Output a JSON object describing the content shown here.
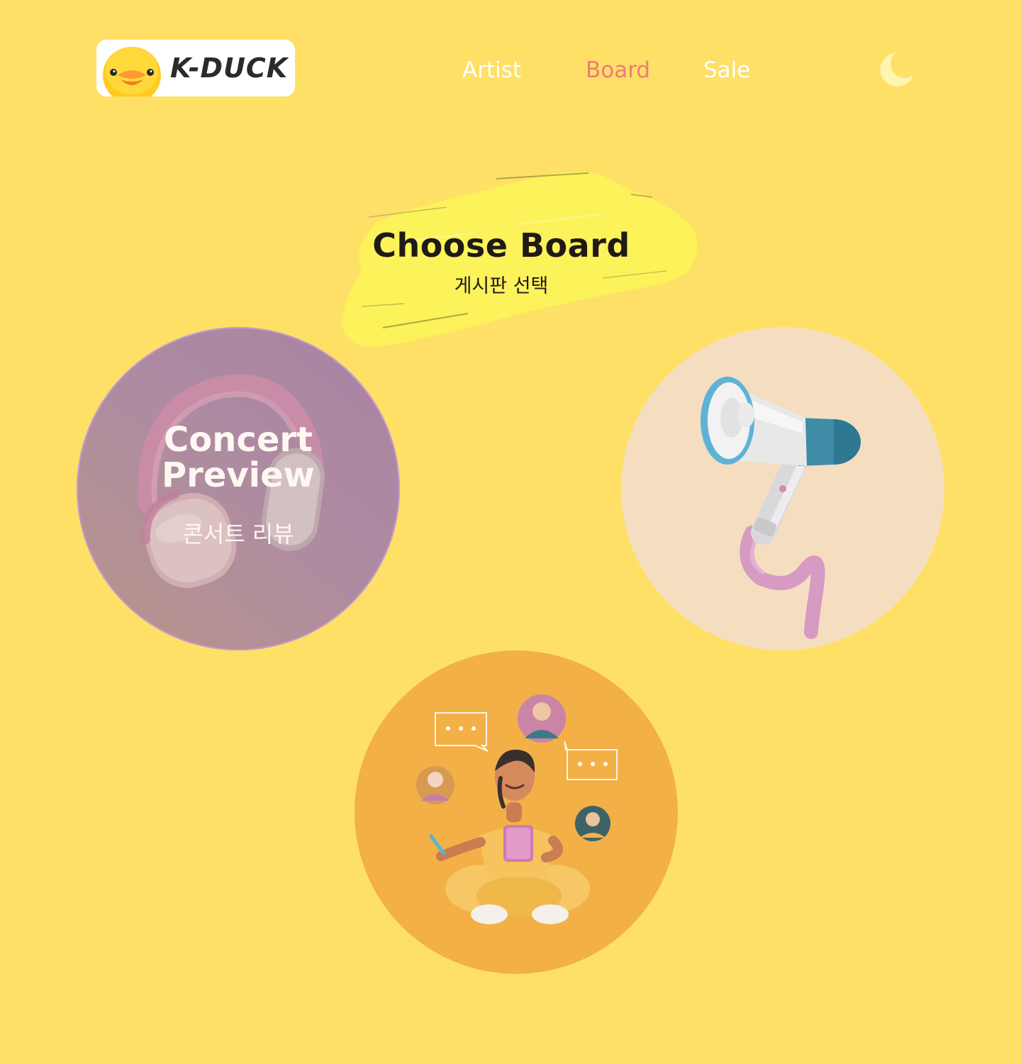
{
  "header": {
    "logo_text": "K-DUCK",
    "nav": {
      "artist": "Artist",
      "board": "Board",
      "sale": "Sale"
    },
    "active_nav": "Board",
    "theme_toggle_icon": "moon-icon"
  },
  "hero": {
    "title": "Choose Board",
    "subtitle": "게시판 선택"
  },
  "boards": {
    "concert": {
      "title_line1": "Concert",
      "title_line2": "Preview",
      "subtitle": "콘서트 리뷰",
      "icon": "headphones-image"
    },
    "notice": {
      "icon": "megaphone-image"
    },
    "community": {
      "icon": "chatting-person-image"
    }
  },
  "colors": {
    "background": "#FFE066",
    "nav_text": "#FFFFFF",
    "nav_active": "#EE7B78",
    "concert_circle": "#AE8CA0",
    "notice_circle": "#F5DEC0",
    "community_circle": "#F2B047",
    "brush_highlight": "#FCF25A"
  }
}
